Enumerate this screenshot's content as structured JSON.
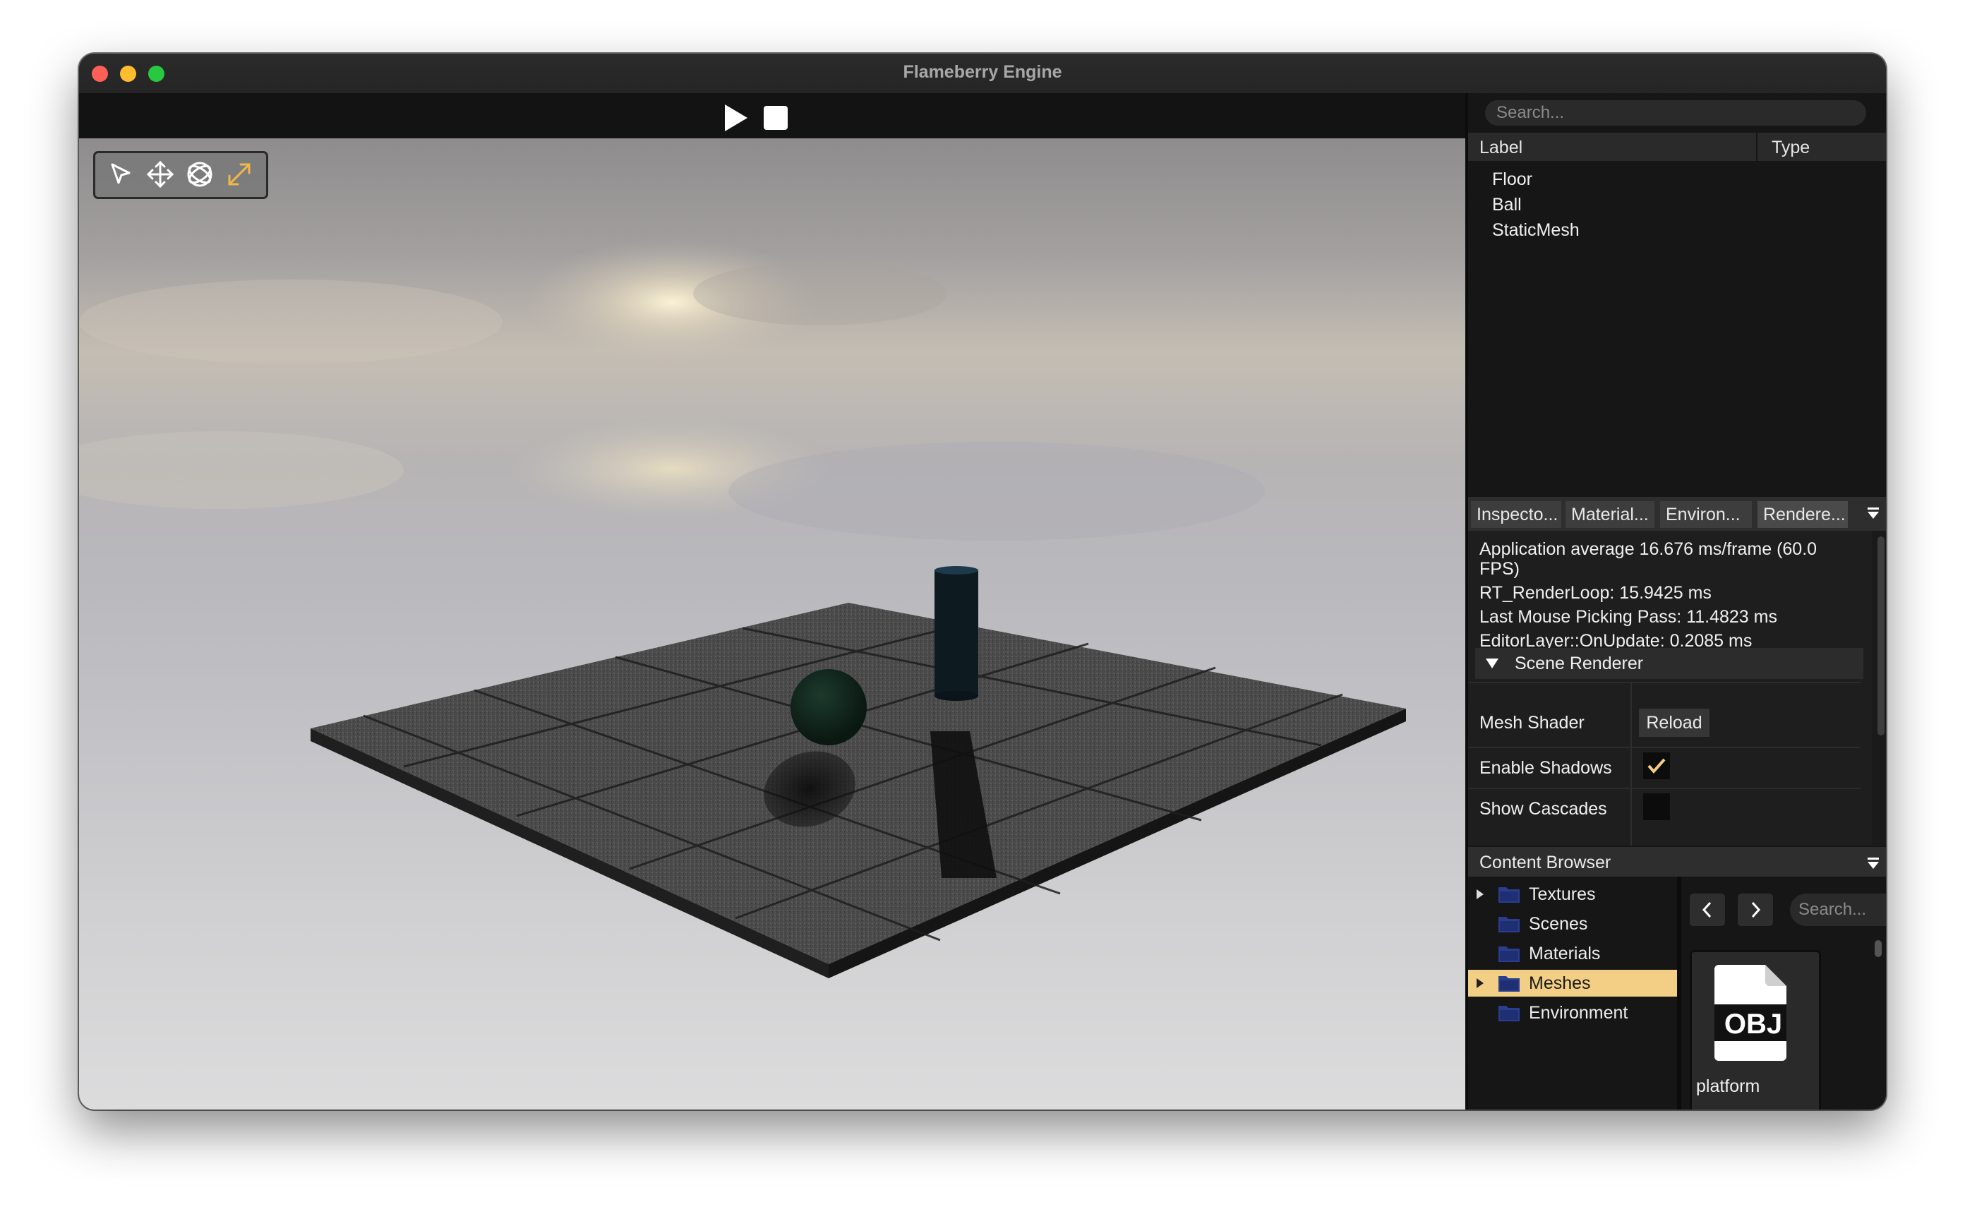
{
  "window": {
    "title": "Flameberry Engine"
  },
  "icons": {
    "play": "play-icon",
    "stop": "stop-icon",
    "select": "select-cursor-icon",
    "translate": "translate-icon",
    "rotate": "rotate-icon",
    "scale": "scale-icon",
    "dropdown": "dropdown-icon",
    "folder": "folder-icon",
    "obj_file": "obj-file-icon"
  },
  "colors": {
    "accent": "#f3cf85",
    "scale_tool": "#f0b84a"
  },
  "hierarchy": {
    "search_placeholder": "Search...",
    "col_label": "Label",
    "col_type": "Type",
    "items": [
      "Floor",
      "Ball",
      "StaticMesh"
    ]
  },
  "tabs": [
    "Inspecto...",
    "Material...",
    "Environ...",
    "Rendere..."
  ],
  "stats": {
    "app_average": "Application average 16.676 ms/frame (60.0 FPS)",
    "render_loop": "RT_RenderLoop: 15.9425 ms",
    "mouse_picking": "Last Mouse Picking Pass: 11.4823 ms",
    "on_update": "EditorLayer::OnUpdate: 0.2085 ms"
  },
  "scene_renderer": {
    "title": "Scene Renderer",
    "mesh_shader_label": "Mesh Shader",
    "reload_label": "Reload",
    "enable_shadows_label": "Enable Shadows",
    "enable_shadows": true,
    "show_cascades_label": "Show Cascades",
    "show_cascades": false
  },
  "content_browser": {
    "title": "Content Browser",
    "search_placeholder": "Search...",
    "folders": [
      {
        "name": "Textures",
        "expandable": true,
        "selected": false
      },
      {
        "name": "Scenes",
        "expandable": false,
        "selected": false
      },
      {
        "name": "Materials",
        "expandable": false,
        "selected": false
      },
      {
        "name": "Meshes",
        "expandable": true,
        "selected": true
      },
      {
        "name": "Environment",
        "expandable": false,
        "selected": false
      }
    ],
    "assets": [
      {
        "name": "platform",
        "badge": "OBJ"
      }
    ]
  }
}
